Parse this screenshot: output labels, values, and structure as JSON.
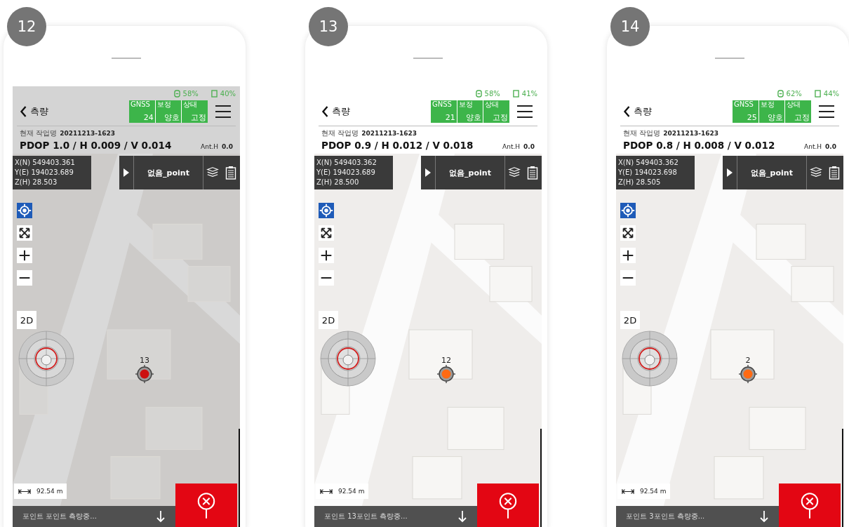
{
  "panels": [
    {
      "step": "12",
      "dimmed": true,
      "status": {
        "gps": "58%",
        "battery": "40%"
      },
      "back_label": "측량",
      "gnss": [
        {
          "label": "GNSS",
          "value": "24"
        },
        {
          "label": "보정",
          "value": "양호"
        },
        {
          "label": "상태",
          "value": "고정"
        }
      ],
      "job": {
        "label": "현재 작업명",
        "value": "20211213-1623"
      },
      "accuracy": "PDOP 1.0 / H 0.009 / V 0.014",
      "ant_h": {
        "label": "Ant.H",
        "value": "0.0"
      },
      "coords": [
        "X(N) 549403.361",
        "Y(E) 194023.689",
        "Z(H) 28.503"
      ],
      "point_name": "없음_point",
      "view_mode": "2D",
      "scale": "92.54 m",
      "marker": {
        "label": "13",
        "color": "#cc1111"
      },
      "message": "포인트 포인트 측량중..."
    },
    {
      "step": "13",
      "dimmed": false,
      "status": {
        "gps": "58%",
        "battery": "41%"
      },
      "back_label": "측량",
      "gnss": [
        {
          "label": "GNSS",
          "value": "21"
        },
        {
          "label": "보정",
          "value": "양호"
        },
        {
          "label": "상태",
          "value": "고정"
        }
      ],
      "job": {
        "label": "현재 작업명",
        "value": "20211213-1623"
      },
      "accuracy": "PDOP 0.9 / H 0.012 / V 0.018",
      "ant_h": {
        "label": "Ant.H",
        "value": "0.0"
      },
      "coords": [
        "X(N) 549403.362",
        "Y(E) 194023.689",
        "Z(H) 28.500"
      ],
      "point_name": "없음_point",
      "view_mode": "2D",
      "scale": "92.54 m",
      "marker": {
        "label": "12",
        "color": "#ff6a13"
      },
      "message": "포인트 13포인트 측량중..."
    },
    {
      "step": "14",
      "dimmed": false,
      "status": {
        "gps": "62%",
        "battery": "44%"
      },
      "back_label": "측량",
      "gnss": [
        {
          "label": "GNSS",
          "value": "25"
        },
        {
          "label": "보정",
          "value": "양호"
        },
        {
          "label": "상태",
          "value": "고정"
        }
      ],
      "job": {
        "label": "현재 작업명",
        "value": "20211213-1623"
      },
      "accuracy": "PDOP 0.8 / H 0.008 / V 0.012",
      "ant_h": {
        "label": "Ant.H",
        "value": "0.0"
      },
      "coords": [
        "X(N) 549403.362",
        "Y(E) 194023.698",
        "Z(H) 28.505"
      ],
      "point_name": "없음_point",
      "view_mode": "2D",
      "scale": "92.54 m",
      "marker": {
        "label": "2",
        "color": "#ff6a13"
      },
      "message": "포인트 3포인트 측량중..."
    }
  ]
}
